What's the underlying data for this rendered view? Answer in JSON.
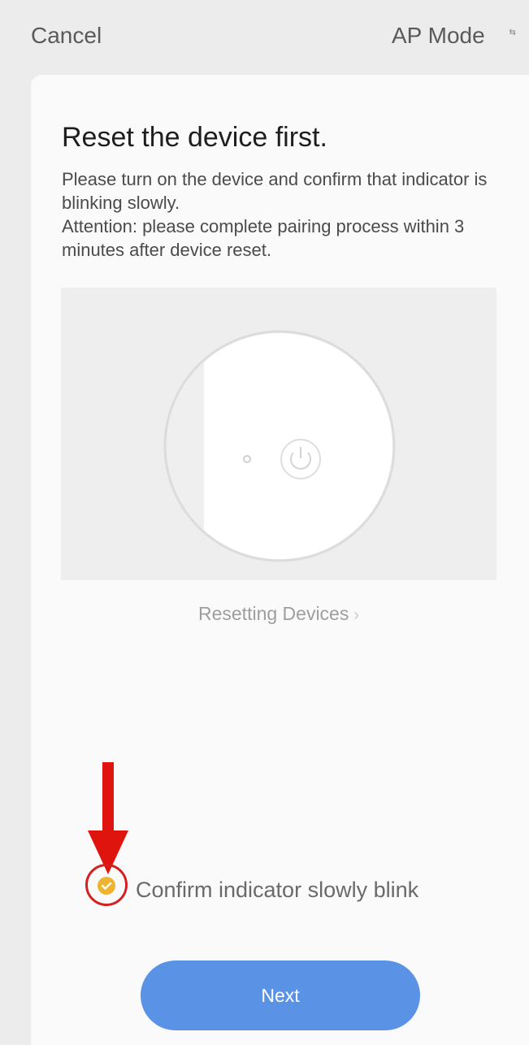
{
  "header": {
    "cancel_label": "Cancel",
    "mode_label": "AP Mode",
    "mode_icon": "switch-arrows-icon"
  },
  "main": {
    "title": "Reset the device first.",
    "instructions": [
      "Please turn on the device and confirm that indicator is blinking slowly.",
      "Attention: please complete pairing process within 3 minutes after device reset."
    ],
    "illustration": {
      "subject": "device-power-button-icon"
    },
    "reset_link_label": "Resetting Devices",
    "reset_link_chevron": "›"
  },
  "footer": {
    "confirm_checked": true,
    "confirm_label": "Confirm indicator slowly blink",
    "next_label": "Next"
  },
  "colors": {
    "accent": "#5a93e6",
    "check": "#eeb431",
    "highlight": "#d42020",
    "background": "#ececec",
    "card": "#fafafa"
  }
}
